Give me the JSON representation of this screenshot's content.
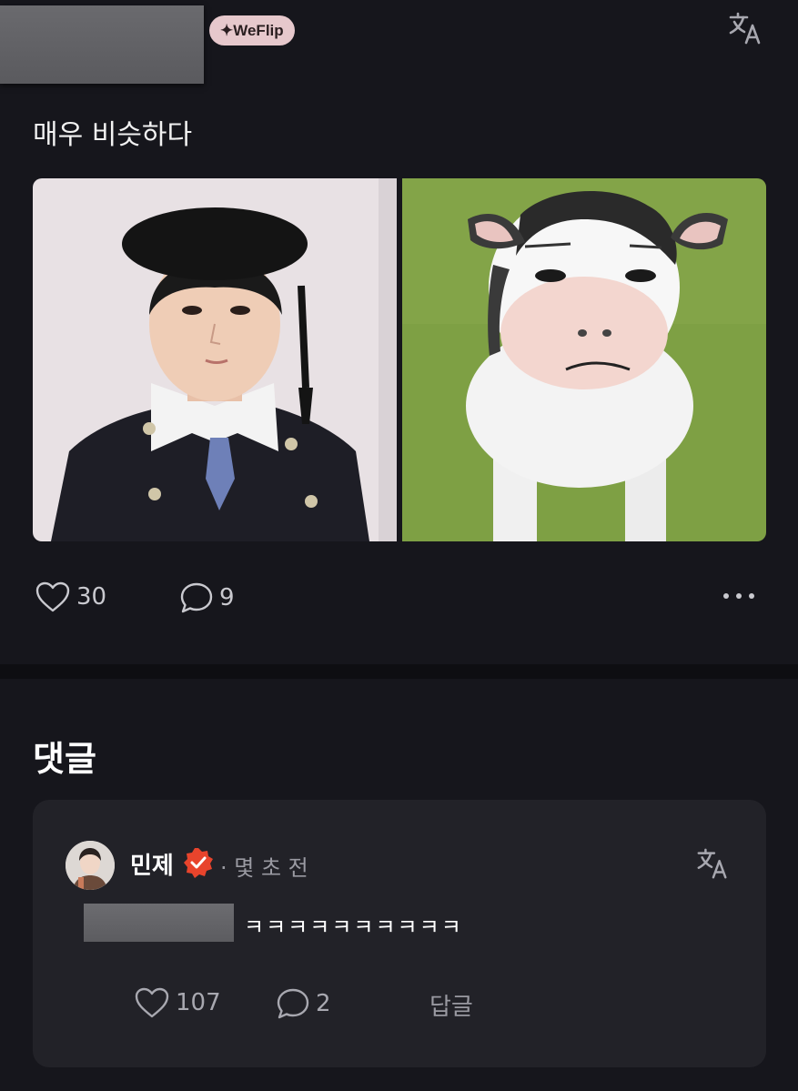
{
  "post": {
    "badge": "✦WeFlip",
    "text": "매우 비슷하다",
    "likes": "30",
    "comments": "9"
  },
  "comments_section": {
    "heading": "댓글",
    "comment": {
      "author": "민제",
      "time": "· 몇 초 전",
      "text": "ㅋㅋㅋㅋㅋㅋㅋㅋㅋㅋ",
      "likes": "107",
      "replies": "2",
      "reply_label": "답글"
    }
  },
  "icons": {
    "translate": "translate-icon",
    "like": "heart-icon",
    "comment": "speech-bubble-icon",
    "more": "more-dots-icon",
    "verified": "verified-badge-icon"
  },
  "colors": {
    "background": "#16161c",
    "card": "#222228",
    "badge_bg": "#e6c8cc",
    "verified": "#e8442c",
    "muted_text": "#9a9aa2"
  }
}
